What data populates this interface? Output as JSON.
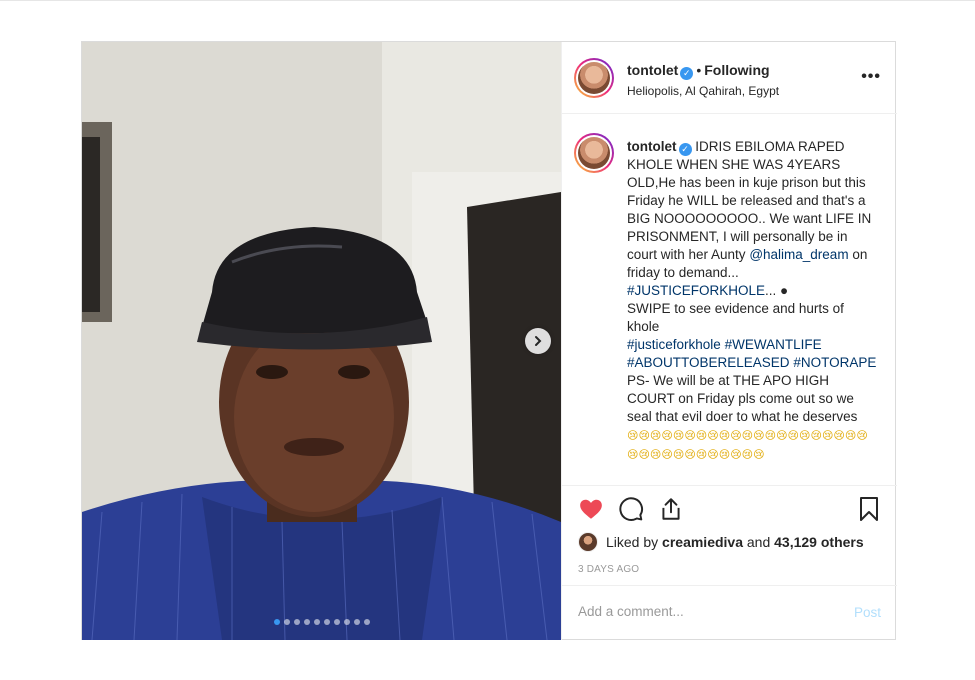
{
  "post": {
    "username": "tontolet",
    "follow_status": "Following",
    "location": "Heliopolis, Al Qahirah, Egypt",
    "more_icon": "more-options-icon"
  },
  "caption": {
    "username": "tontolet",
    "text1": "IDRIS EBILOMA RAPED KHOLE WHEN SHE WAS 4YEARS OLD,He has been in kuje prison but this Friday he WILL be released and that's a BIG NOOOOOOOOO.. We want LIFE IN PRISONMENT, I will personally be in court with her Aunty ",
    "mention": "@halima_dream",
    "text2": " on friday to demand...",
    "hashtag1": "#JUSTICEFORKHOLE",
    "text3": "... ●",
    "text4": "SWIPE to see evidence and hurts of khole",
    "hashtag2": "#justiceforkhole",
    "hashtag3": "#WEWANTLIFE",
    "hashtag4": "#ABOUTTOBERELEASED",
    "hashtag5": "#NOTORAPE",
    "text5": "PS- We will be at THE APO HIGH COURT on Friday pls come out so we seal that evil doer to what he deserves",
    "emojis": "😢😢😢😢😢😢😢😢😢😢😢😢😢😢😢😢😢😢😢😢😢😢😢😢😢😢😢😢😢😢😢😢😢"
  },
  "carousel": {
    "dot_count": 10,
    "active_index": 0
  },
  "likes": {
    "prefix": "Liked by ",
    "liker": "creamiediva",
    "middle": " and ",
    "count": "43,129 others"
  },
  "time": "3 DAYS AGO",
  "comment": {
    "placeholder": "Add a comment...",
    "post_label": "Post"
  },
  "colors": {
    "link": "#003569",
    "accent": "#3897f0",
    "like_red": "#ed4956"
  }
}
